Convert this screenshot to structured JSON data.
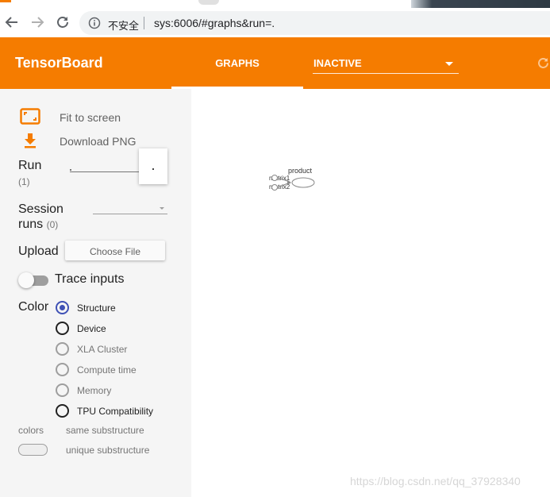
{
  "browser": {
    "security_label": "不安全",
    "url": "sys:6006/#graphs&run=."
  },
  "header": {
    "title": "TensorBoard",
    "tabs": [
      {
        "label": "GRAPHS",
        "active": true
      }
    ],
    "inactive_select": {
      "value": "INACTIVE"
    }
  },
  "sidebar": {
    "fit_label": "Fit to screen",
    "download_label": "Download PNG",
    "run": {
      "label": "Run",
      "count": "(1)",
      "value": "."
    },
    "session": {
      "label_line1": "Session",
      "label_line2": "runs",
      "count": "(0)"
    },
    "upload": {
      "label": "Upload",
      "button": "Choose File"
    },
    "trace": {
      "label": "Trace inputs",
      "enabled": false
    },
    "color": {
      "label": "Color",
      "options": [
        {
          "label": "Structure",
          "checked": true,
          "enabled": true
        },
        {
          "label": "Device",
          "checked": false,
          "enabled": true
        },
        {
          "label": "XLA Cluster",
          "checked": false,
          "enabled": false
        },
        {
          "label": "Compute time",
          "checked": false,
          "enabled": false
        },
        {
          "label": "Memory",
          "checked": false,
          "enabled": false
        },
        {
          "label": "TPU Compatibility",
          "checked": false,
          "enabled": true
        }
      ]
    },
    "legend": {
      "colors": "colors",
      "same": "same substructure",
      "unique": "unique substructure"
    }
  },
  "graph": {
    "nodes": {
      "input1": "matrix1",
      "input2": "matrix2",
      "op": "product"
    },
    "watermark": "https://blog.csdn.net/qq_37928340"
  },
  "colors": {
    "accent": "#f57c00",
    "radio_checked": "#3f51b5"
  }
}
